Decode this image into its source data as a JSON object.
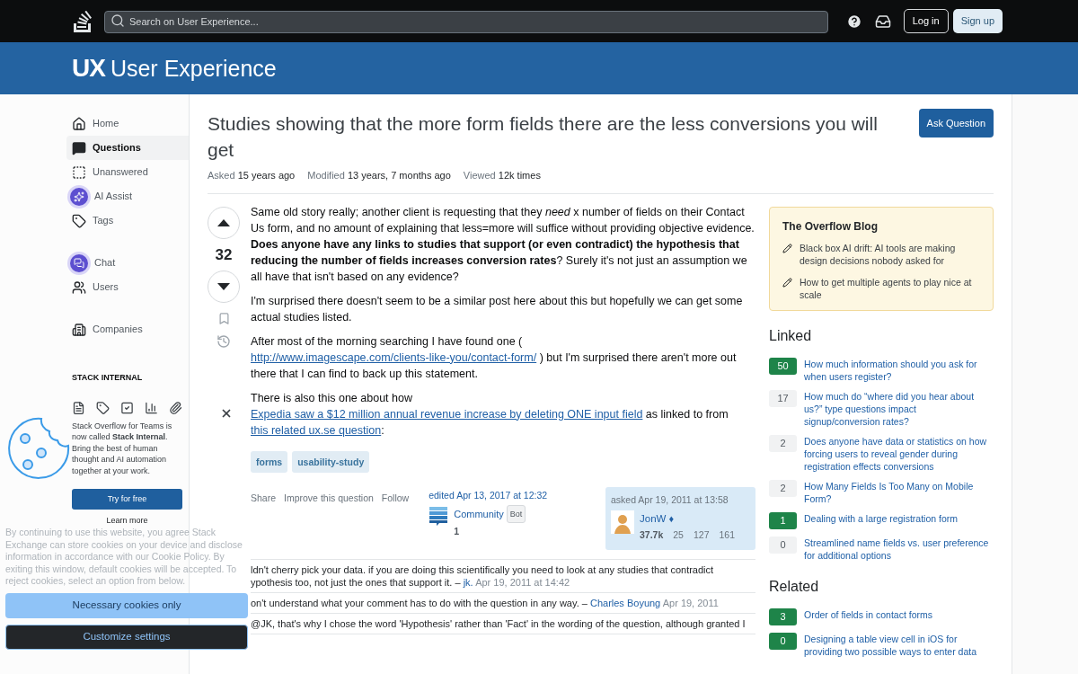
{
  "topbar": {
    "search": {
      "placeholder": "Search on User Experience..."
    },
    "buttons": [
      {
        "label": "Log in",
        "kind": "outline"
      },
      {
        "label": "Sign up",
        "kind": "filled"
      }
    ]
  },
  "site": {
    "logo_mark": "UX",
    "name": "User Experience"
  },
  "sidebar": {
    "nav_groups": [
      [
        {
          "label": "Home",
          "selected": false
        },
        {
          "label": "Questions",
          "selected": true
        },
        {
          "label": "Unanswered",
          "selected": false
        },
        {
          "label": "AI Assist",
          "selected": false
        },
        {
          "label": "Tags",
          "selected": false
        }
      ],
      [
        {
          "label": "Chat",
          "selected": false
        },
        {
          "label": "Users",
          "selected": false
        }
      ],
      [
        {
          "label": "Companies",
          "selected": false
        }
      ]
    ],
    "section_title": "STACK INTERNAL",
    "promo": "Stack Overflow for Teams is now called **Stack Internal**. Bring the best of human thought and AI automation together at your work.",
    "cta": "Try for free",
    "learn_more": "Learn more"
  },
  "question": {
    "title": "Studies showing that the more form fields there are the less conversions you will get",
    "ask_button": "Ask Question",
    "meta": [
      {
        "label": "Asked",
        "value": "15 years ago"
      },
      {
        "label": "Modified",
        "value": "13 years, 7 months ago"
      },
      {
        "label": "Viewed",
        "value": "12k times"
      }
    ],
    "score": "32",
    "body": [
      [
        {
          "kind": "text",
          "text": "Same old story really; another client is requesting that they *need* x number of fields on their Contact Us form, and no amount of explaining that less=more will suffice without providing objective evidence. **Does anyone have any links to studies that support (or even contradict) the hypothesis that reducing the number of fields increases conversion rates**? Surely it's not just an assumption we all have that isn't based on any evidence?"
        }
      ],
      [
        {
          "kind": "text",
          "text": "I'm surprised there doesn't seem to be a similar post here about this but hopefully we can get some actual studies listed."
        }
      ],
      [
        {
          "kind": "text",
          "text": "After most of the morning searching I have found one ( "
        },
        {
          "kind": "link",
          "text": "http://www.imagescape.com/clients-like-you/contact-form/"
        },
        {
          "kind": "text",
          "text": " ) but I'm surprised there aren't more out there that I can find to back up this statement."
        }
      ],
      [
        {
          "kind": "text",
          "text": "There is also this one about how "
        },
        {
          "kind": "link",
          "text": "Expedia saw a $12 million annual revenue increase by deleting ONE input field"
        },
        {
          "kind": "text",
          "text": " as linked to from "
        },
        {
          "kind": "link",
          "text": "this related ux.se question"
        },
        {
          "kind": "text",
          "text": ":"
        }
      ]
    ],
    "tags": [
      "forms",
      "usability-study"
    ],
    "actions": [
      "Share",
      "Improve this question",
      "Follow"
    ],
    "edited": {
      "label": "edited Apr 13, 2017 at 12:32",
      "user": "Community",
      "badge": "Bot",
      "reputation": "1"
    },
    "asked": {
      "label": "asked Apr 19, 2011 at 13:58",
      "user": "JonW",
      "moderator_mark": "♦",
      "reputation": "37.7k",
      "badges": [
        "25",
        "127",
        "161"
      ]
    },
    "comments": [
      {
        "text": "ldn't cherry pick your data. if you are doing this scientifically you need to look at any studies that contradict ypothesis too, not just the ones that support it.",
        "separator": "–",
        "author": "jk.",
        "date": "Apr 19, 2011 at 14:42"
      },
      {
        "text": "on't understand what your comment has to do with the question in any way.",
        "separator": "–",
        "author": "Charles Boyung",
        "date": "Apr 19, 2011"
      },
      {
        "text": "@JK, that's why I chose the word 'Hypothesis' rather than 'Fact' in the wording of the question, although granted I"
      }
    ]
  },
  "right": {
    "blog": {
      "title": "The Overflow Blog",
      "items": [
        "Black box AI drift: AI tools are making design decisions nobody asked for",
        "How to get multiple agents to play nice at scale"
      ]
    },
    "linked": {
      "title": "Linked",
      "items": [
        {
          "score": "50",
          "title": "How much information should you ask for when users register?",
          "accepted": true
        },
        {
          "score": "17",
          "title": "How much do “where did you hear about us?” type questions impact signup/conversion rates?",
          "accepted": false
        },
        {
          "score": "2",
          "title": "Does anyone have data or statistics on how forcing users to reveal gender during registration effects conversions",
          "accepted": false
        },
        {
          "score": "2",
          "title": "How Many Fields Is Too Many on Mobile Form?",
          "accepted": false
        },
        {
          "score": "1",
          "title": "Dealing with a large registration form",
          "accepted": true
        },
        {
          "score": "0",
          "title": "Streamlined name fields vs. user preference for additional options",
          "accepted": false
        }
      ]
    },
    "related": {
      "title": "Related",
      "items": [
        {
          "score": "3",
          "title": "Order of fields in contact forms",
          "accepted": true
        },
        {
          "score": "0",
          "title": "Designing a table view cell in iOS for providing two possible ways to enter data",
          "accepted": true
        }
      ]
    }
  },
  "cookie_banner": {
    "text": "By continuing to use this website, you agree Stack Exchange can store cookies on your device and disclose information in accordance with our Cookie Policy. By exiting this window, default cookies will be accepted. To reject cookies, select an option from below.",
    "buttons": [
      {
        "label": "Necessary cookies only",
        "kind": "primary"
      },
      {
        "label": "Customize settings",
        "kind": "dark"
      }
    ]
  }
}
